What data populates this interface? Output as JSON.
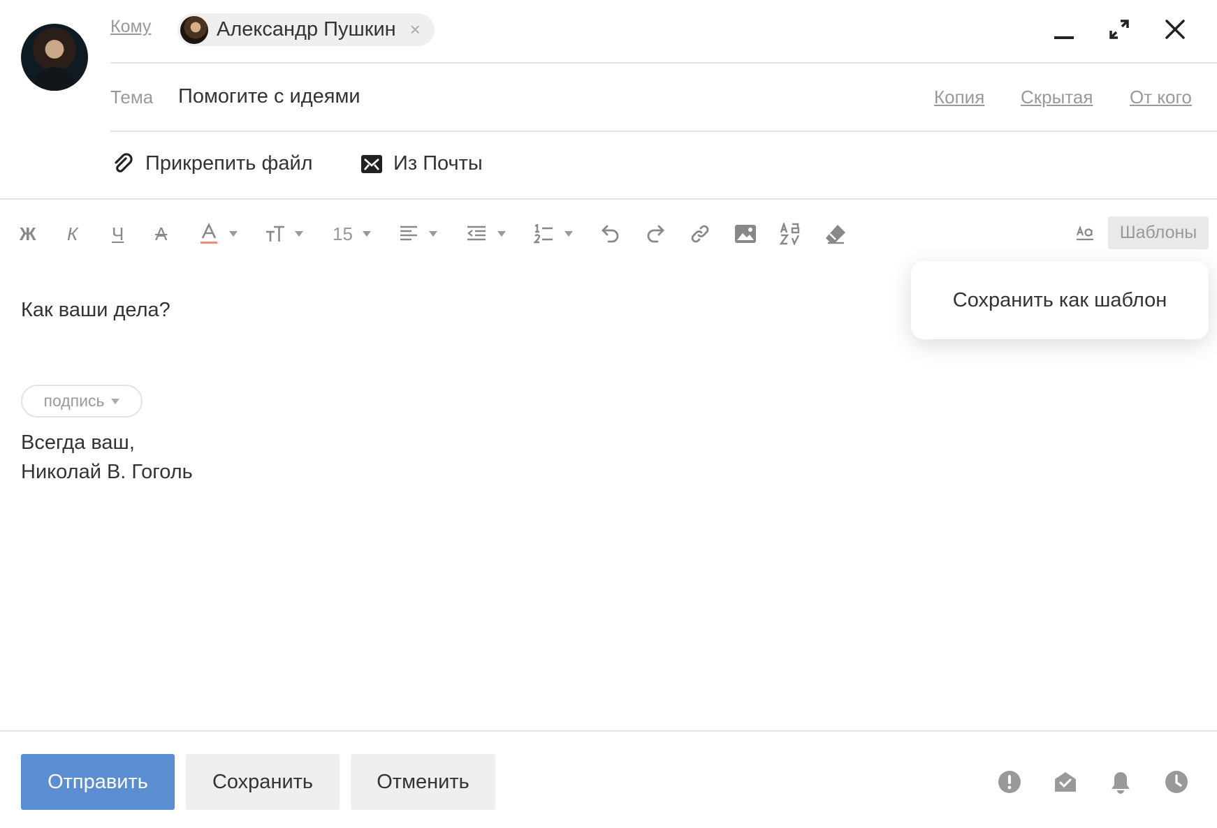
{
  "header": {
    "to_label": "Кому",
    "recipient": {
      "name": "Александр Пушкин",
      "remove": "×"
    },
    "subject_label": "Тема",
    "subject": "Помогите с идеями",
    "links": {
      "cc": "Копия",
      "bcc": "Скрытая",
      "from": "От кого"
    },
    "attach_file": "Прикрепить файл",
    "from_mail": "Из Почты"
  },
  "toolbar": {
    "bold": "Ж",
    "italic": "К",
    "underline": "Ч",
    "strike": "А",
    "font_size": "15",
    "templates": "Шаблоны"
  },
  "templates_menu": {
    "items": [
      "Сохранить как шаблон"
    ]
  },
  "body": {
    "text": "Как ваши дела?",
    "signature_label": "подпись",
    "signature_lines": [
      "Всегда ваш,",
      "Николай В. Гоголь"
    ]
  },
  "footer": {
    "send": "Отправить",
    "save": "Сохранить",
    "cancel": "Отменить"
  },
  "colors": {
    "accent": "#5a8ed1",
    "text": "#333333",
    "muted": "#999999",
    "text_color_underline": "#f08c78"
  }
}
